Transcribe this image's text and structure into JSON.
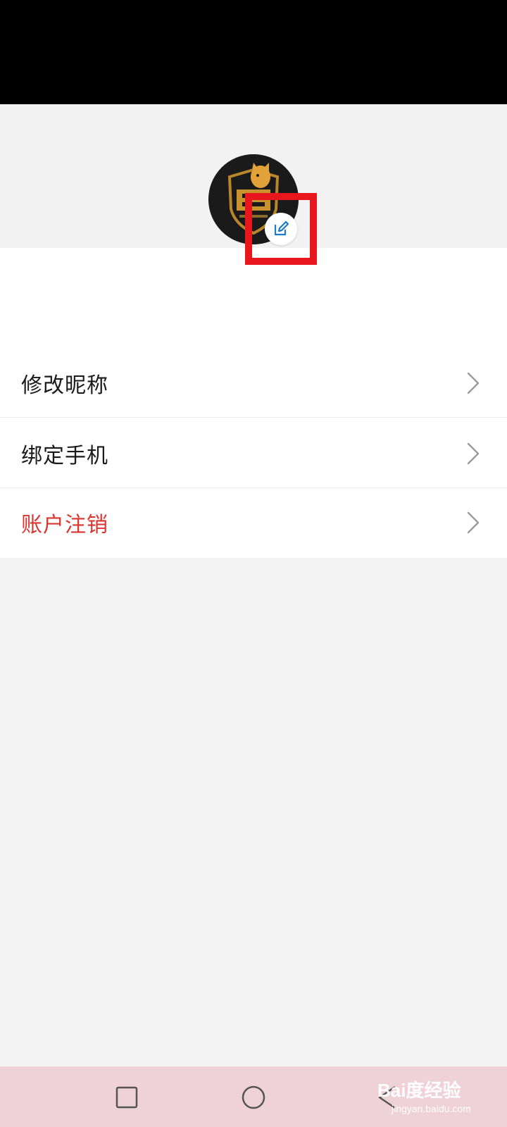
{
  "menu": {
    "items": [
      {
        "label": "修改昵称",
        "style": "normal"
      },
      {
        "label": "绑定手机",
        "style": "normal"
      },
      {
        "label": "账户注销",
        "style": "danger"
      }
    ]
  },
  "profile": {
    "avatar_icon": "shield-cat-logo",
    "edit_icon": "edit-icon"
  },
  "colors": {
    "highlight": "#e8161d",
    "danger_text": "#d9362f",
    "accent_edit": "#1e79c8",
    "navbar_bg": "#efd2d7"
  },
  "watermark": {
    "main": "Bai度经验",
    "sub": "jingyan.baidu.com"
  }
}
